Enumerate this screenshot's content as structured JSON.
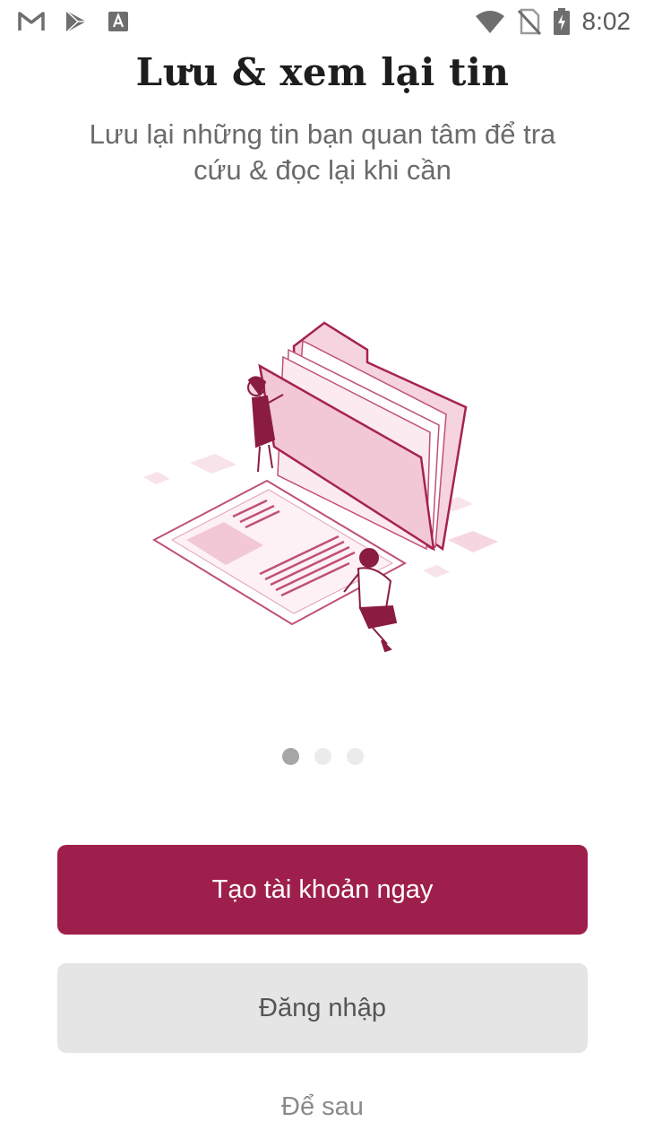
{
  "status_bar": {
    "time": "8:02",
    "left_icons": [
      "gmail-icon",
      "play-store-icon",
      "keyboard-a-icon"
    ],
    "right_icons": [
      "wifi-icon",
      "no-sim-icon",
      "battery-charging-icon"
    ]
  },
  "onboarding": {
    "title": "Lưu & xem lại tin",
    "subtitle": "Lưu lại những tin bạn quan tâm để tra cứu & đọc lại khi cần",
    "illustration": "folder-documents-illustration",
    "page_indicator": {
      "total": 3,
      "active": 1
    }
  },
  "actions": {
    "create_account_label": "Tạo tài khoản ngay",
    "login_label": "Đăng nhập",
    "later_label": "Để sau"
  },
  "colors": {
    "primary": "#9e1f4b",
    "secondary_bg": "#e5e5e5",
    "illustration_fill": "#f5d3df",
    "illustration_stroke": "#b2305f"
  }
}
